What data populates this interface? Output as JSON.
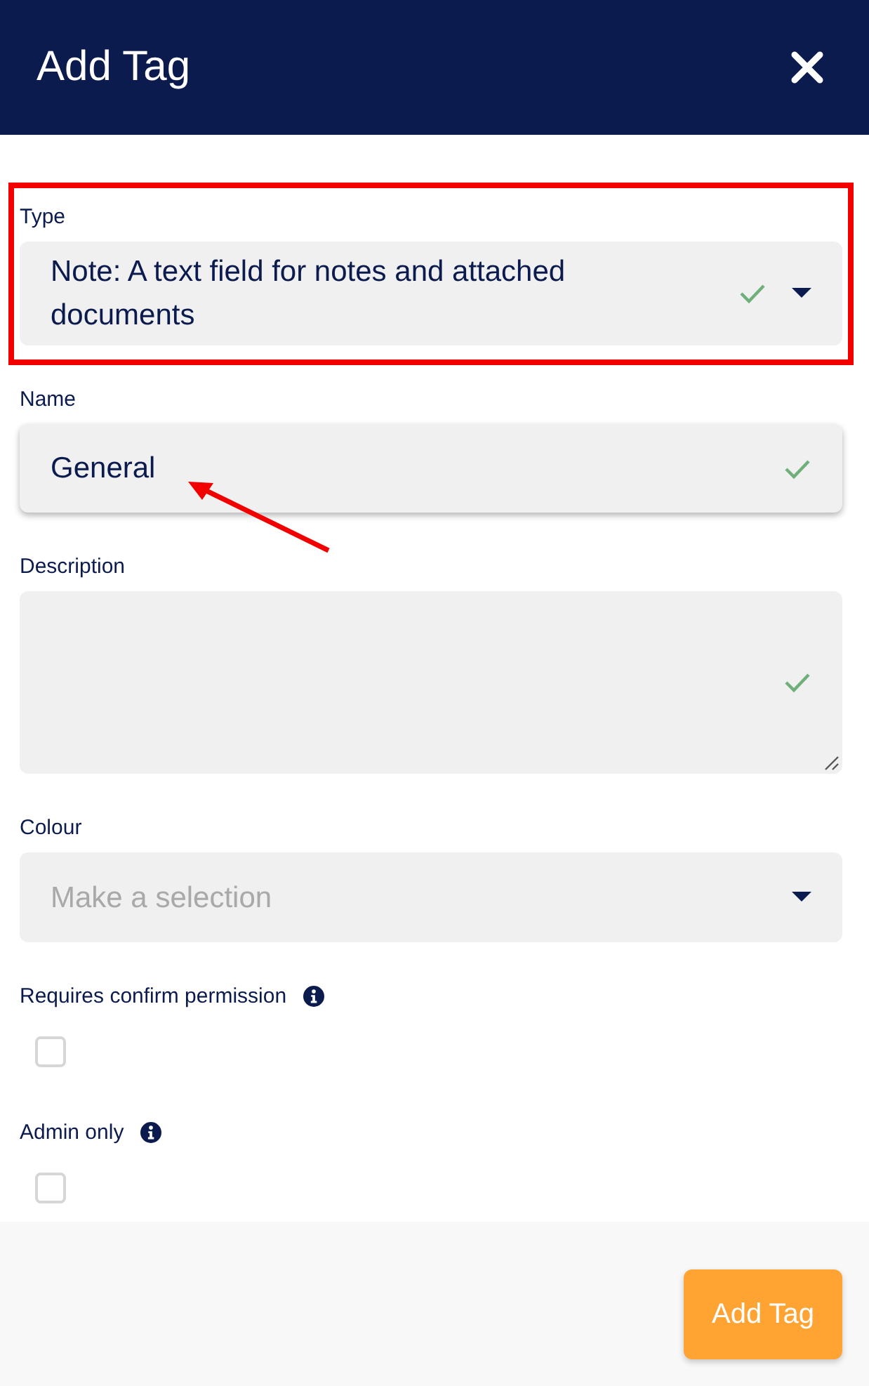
{
  "dialog": {
    "title": "Add Tag"
  },
  "fields": [
    {
      "kind": "select",
      "label": "Type",
      "value": "Note: A text field for notes and attached documents",
      "valid": true,
      "focused": false,
      "highlighted": true,
      "pointed_at": false
    },
    {
      "kind": "text",
      "label": "Name",
      "value": "General",
      "valid": true,
      "focused": true,
      "highlighted": false,
      "pointed_at": true
    },
    {
      "kind": "textarea",
      "label": "Description",
      "valid": true,
      "focused": false,
      "highlighted": false,
      "pointed_at": false
    },
    {
      "kind": "select",
      "label": "Colour",
      "placeholder": "Make a selection",
      "valid": false,
      "focused": false,
      "highlighted": false,
      "pointed_at": false
    }
  ],
  "checkboxes": [
    {
      "label": "Requires confirm permission",
      "checked": false,
      "info": true
    },
    {
      "label": "Admin only",
      "checked": false,
      "info": true
    }
  ],
  "footer": {
    "button": "Add Tag"
  }
}
